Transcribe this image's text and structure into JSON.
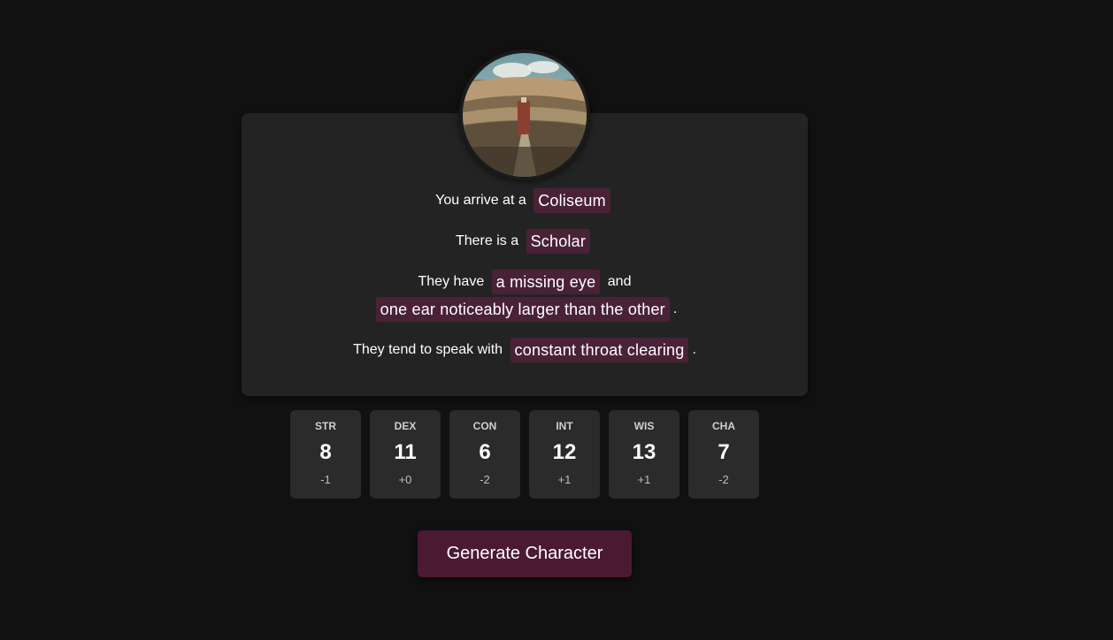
{
  "avatar": {
    "icon": "coliseum-image"
  },
  "description": {
    "location_prefix": "You arrive at a",
    "location": "Coliseum",
    "person_prefix": "There is a",
    "person": "Scholar",
    "features_prefix": "They have",
    "feature_1": "a missing eye",
    "features_joiner": "and",
    "feature_2": "one ear noticeably larger than the other",
    "features_suffix": ".",
    "speech_prefix": "They tend to speak with",
    "speech": "constant throat clearing",
    "speech_suffix": "."
  },
  "stats": [
    {
      "name": "STR",
      "value": "8",
      "modifier": "-1"
    },
    {
      "name": "DEX",
      "value": "11",
      "modifier": "+0"
    },
    {
      "name": "CON",
      "value": "6",
      "modifier": "-2"
    },
    {
      "name": "INT",
      "value": "12",
      "modifier": "+1"
    },
    {
      "name": "WIS",
      "value": "13",
      "modifier": "+1"
    },
    {
      "name": "CHA",
      "value": "7",
      "modifier": "-2"
    }
  ],
  "generate_button": {
    "label": "Generate Character"
  },
  "colors": {
    "background": "#111111",
    "card": "#232323",
    "tag": "#4a2237",
    "stat_box": "#2b2b2b",
    "button": "#4a1a33"
  }
}
